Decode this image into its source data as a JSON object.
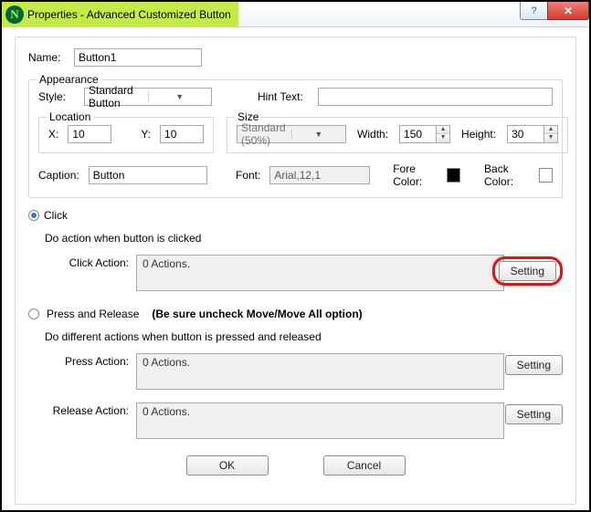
{
  "window": {
    "title": "Properties - Advanced Customized Button"
  },
  "name": {
    "label": "Name:",
    "value": "Button1"
  },
  "appearance": {
    "legend": "Appearance",
    "style": {
      "label": "Style:",
      "value": "Standard Button"
    },
    "hint": {
      "label": "Hint Text:",
      "value": ""
    },
    "location": {
      "legend": "Location",
      "x": {
        "label": "X:",
        "value": "10"
      },
      "y": {
        "label": "Y:",
        "value": "10"
      }
    },
    "size": {
      "legend": "Size",
      "preset": "Standard  (50%)",
      "width": {
        "label": "Width:",
        "value": "150"
      },
      "height": {
        "label": "Height:",
        "value": "30"
      }
    },
    "caption": {
      "label": "Caption:",
      "value": "Button"
    },
    "font": {
      "label": "Font:",
      "value": "Arial,12,1"
    },
    "forecolor": {
      "label": "Fore Color:"
    },
    "backcolor": {
      "label": "Back Color:"
    }
  },
  "click": {
    "radio": "Click",
    "note": "Do action when button is clicked",
    "action_label": "Click Action:",
    "action_value": "0 Actions.",
    "setting": "Setting"
  },
  "press": {
    "radio": "Press and Release",
    "bold_note": "(Be sure uncheck Move/Move All option)",
    "note": "Do different actions when button is pressed and released",
    "press_label": "Press Action:",
    "press_value": "0 Actions.",
    "release_label": "Release Action:",
    "release_value": "0 Actions.",
    "setting": "Setting"
  },
  "dialog": {
    "ok": "OK",
    "cancel": "Cancel"
  }
}
